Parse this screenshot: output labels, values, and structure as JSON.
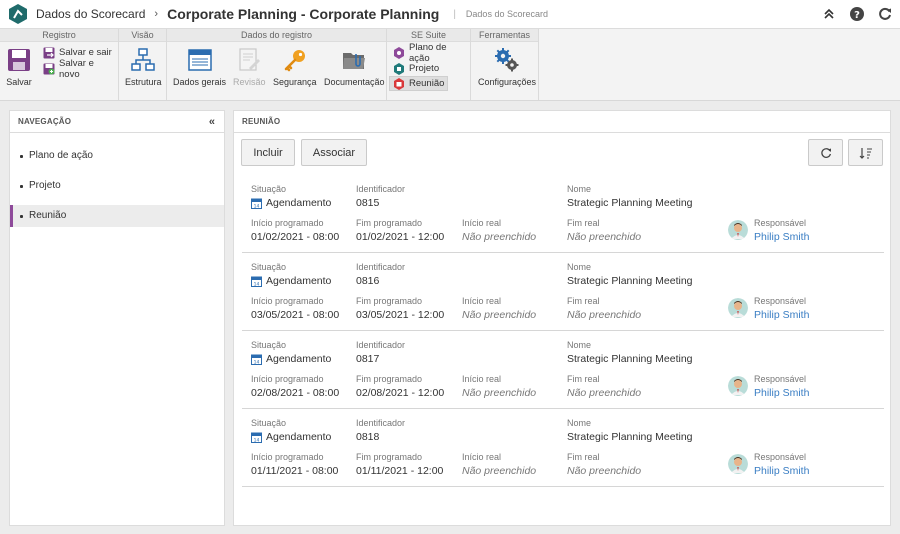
{
  "app": {
    "name": "Dados do Scorecard",
    "title": "Corporate Planning - Corporate Planning",
    "subtitle": "Dados do Scorecard"
  },
  "ribbon": {
    "registro": {
      "title": "Registro",
      "save": "Salvar",
      "save_exit": "Salvar e sair",
      "save_new": "Salvar e novo"
    },
    "visao": {
      "title": "Visão",
      "estrutura": "Estrutura"
    },
    "dados": {
      "title": "Dados do registro",
      "gerais": "Dados gerais",
      "revisao": "Revisão",
      "seguranca": "Segurança",
      "documentacao": "Documentação"
    },
    "suite": {
      "title": "SE Suite",
      "plano": "Plano de ação",
      "projeto": "Projeto",
      "reuniao": "Reunião"
    },
    "ferramentas": {
      "title": "Ferramentas",
      "config": "Configurações"
    }
  },
  "nav": {
    "title": "NAVEGAÇÃO",
    "items": [
      "Plano de ação",
      "Projeto",
      "Reunião"
    ],
    "active_index": 2
  },
  "main": {
    "title": "REUNIÃO",
    "include": "Incluir",
    "associate": "Associar"
  },
  "labels": {
    "situacao": "Situação",
    "identificador": "Identificador",
    "nome": "Nome",
    "inicio_prog": "Início programado",
    "fim_prog": "Fim programado",
    "inicio_real": "Início real",
    "fim_real": "Fim real",
    "responsavel": "Responsável"
  },
  "records": [
    {
      "situacao": "Agendamento",
      "id": "0815",
      "nome": "Strategic Planning Meeting",
      "inicio_prog": "01/02/2021 - 08:00",
      "fim_prog": "01/02/2021 - 12:00",
      "inicio_real": "Não preenchido",
      "fim_real": "Não preenchido",
      "responsavel": "Philip Smith"
    },
    {
      "situacao": "Agendamento",
      "id": "0816",
      "nome": "Strategic Planning Meeting",
      "inicio_prog": "03/05/2021 - 08:00",
      "fim_prog": "03/05/2021 - 12:00",
      "inicio_real": "Não preenchido",
      "fim_real": "Não preenchido",
      "responsavel": "Philip Smith"
    },
    {
      "situacao": "Agendamento",
      "id": "0817",
      "nome": "Strategic Planning Meeting",
      "inicio_prog": "02/08/2021 - 08:00",
      "fim_prog": "02/08/2021 - 12:00",
      "inicio_real": "Não preenchido",
      "fim_real": "Não preenchido",
      "responsavel": "Philip Smith"
    },
    {
      "situacao": "Agendamento",
      "id": "0818",
      "nome": "Strategic Planning Meeting",
      "inicio_prog": "01/11/2021 - 08:00",
      "fim_prog": "01/11/2021 - 12:00",
      "inicio_real": "Não preenchido",
      "fim_real": "Não preenchido",
      "responsavel": "Philip Smith"
    }
  ],
  "colors": {
    "brand": "#1f6b6b",
    "active_bar": "#8e4a9a",
    "link": "#3a7ec4"
  },
  "icons": [
    "app-logo-icon",
    "collapse-up-icon",
    "help-icon",
    "refresh-icon",
    "save-icon",
    "save-exit-icon",
    "save-new-icon",
    "structure-icon",
    "general-data-icon",
    "revision-icon",
    "security-key-icon",
    "documentation-icon",
    "action-plan-icon",
    "project-icon",
    "meeting-icon",
    "settings-gears-icon",
    "calendar-icon",
    "sort-icon",
    "avatar-icon"
  ]
}
